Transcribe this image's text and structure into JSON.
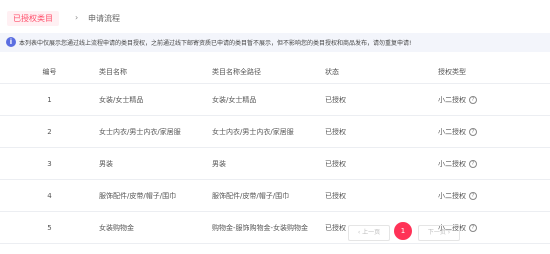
{
  "tabs": {
    "active": "已授权类目",
    "separator": "›",
    "other": "申请流程"
  },
  "notice": {
    "icon": "info-icon",
    "icon_glyph": "i",
    "text": "本列表中仅展示您通过线上流程申请的类目授权，之前通过线下邮寄资质已申请的类目暂不展示，但不影响您的类目授权和商品发布，请勿重复申请!"
  },
  "table": {
    "headers": [
      "编号",
      "类目名称",
      "类目名称全路径",
      "状态",
      "授权类型"
    ],
    "rows": [
      {
        "id": "1",
        "name": "女装/女士精品",
        "path": "女装/女士精品",
        "status": "已授权",
        "type": "小二授权"
      },
      {
        "id": "2",
        "name": "女士内衣/男士内衣/家居服",
        "path": "女士内衣/男士内衣/家居服",
        "status": "已授权",
        "type": "小二授权"
      },
      {
        "id": "3",
        "name": "男装",
        "path": "男装",
        "status": "已授权",
        "type": "小二授权"
      },
      {
        "id": "4",
        "name": "服饰配件/皮带/帽子/围巾",
        "path": "服饰配件/皮带/帽子/围巾",
        "status": "已授权",
        "type": "小二授权"
      },
      {
        "id": "5",
        "name": "女装购物金",
        "path": "购物金-服饰购物金-女装购物金",
        "status": "已授权",
        "type": "小二授权"
      }
    ],
    "help_glyph": "?"
  },
  "pagination": {
    "prev": "‹ 上一页",
    "current": "1",
    "next": "下一页 ›"
  },
  "colors": {
    "accent": "#ff3257",
    "notice_bg": "#f3f5fb",
    "info_icon": "#5b6ee1"
  }
}
